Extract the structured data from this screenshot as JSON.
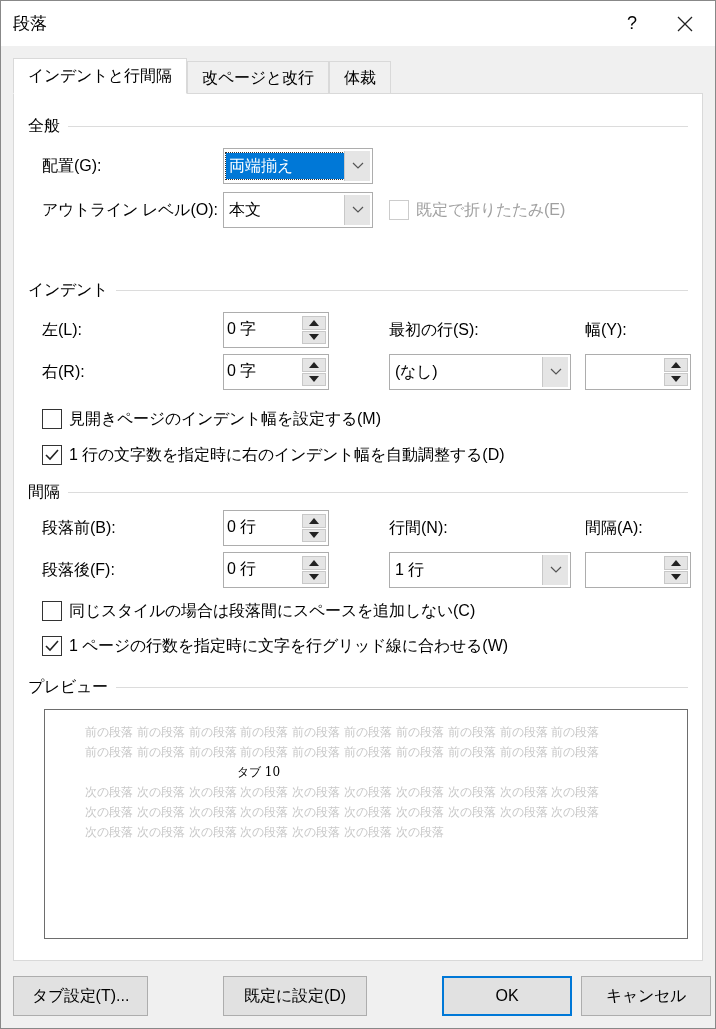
{
  "window": {
    "title": "段落",
    "help": "?"
  },
  "tabs": [
    {
      "label": "インデントと行間隔",
      "selected": true
    },
    {
      "label": "改ページと改行",
      "selected": false
    },
    {
      "label": "体裁",
      "selected": false
    }
  ],
  "general": {
    "title": "全般",
    "alignment": {
      "label": "配置(G):",
      "value": "両端揃え",
      "focused": true
    },
    "outline_level": {
      "label": "アウトライン レベル(O):",
      "value": "本文",
      "focused": false
    },
    "collapse": {
      "label": "既定で折りたたみ(E)",
      "checked": false,
      "disabled": true
    }
  },
  "indent": {
    "title": "インデント",
    "left": {
      "label": "左(L):",
      "value": "0 字"
    },
    "right": {
      "label": "右(R):",
      "value": "0 字"
    },
    "first_line": {
      "label": "最初の行(S):",
      "value": "(なし)",
      "focused": false
    },
    "by": {
      "label": "幅(Y):"
    },
    "checkboxes": [
      {
        "label": "見開きページのインデント幅を設定する(M)",
        "checked": false,
        "disabled": false
      },
      {
        "label": "1 行の文字数を指定時に右のインデント幅を自動調整する(D)",
        "checked": true,
        "disabled": false
      }
    ]
  },
  "spacing": {
    "title": "間隔",
    "before": {
      "label": "段落前(B):",
      "value": "0 行"
    },
    "after": {
      "label": "段落後(F):",
      "value": "0 行"
    },
    "line_spacing": {
      "label": "行間(N):",
      "value": "1 行",
      "focused": false
    },
    "at": {
      "label": "間隔(A):"
    },
    "checkboxes": [
      {
        "label": "同じスタイルの場合は段落間にスペースを追加しない(C)",
        "checked": false,
        "disabled": false
      },
      {
        "label": "1 ページの行数を指定時に文字を行グリッド線に合わせる(W)",
        "checked": true,
        "disabled": false
      }
    ]
  },
  "preview": {
    "title": "プレビュー",
    "lines": [
      {
        "kind": "context",
        "text": "前の段落 前の段落 前の段落 前の段落 前の段落 前の段落 前の段落 前の段落 前の段落 前の段落"
      },
      {
        "kind": "context",
        "text": "前の段落 前の段落 前の段落 前の段落 前の段落 前の段落 前の段落 前の段落 前の段落 前の段落"
      },
      {
        "kind": "sample",
        "text": "タブ 10"
      },
      {
        "kind": "context",
        "text": "次の段落 次の段落 次の段落 次の段落 次の段落 次の段落 次の段落 次の段落 次の段落 次の段落"
      },
      {
        "kind": "context",
        "text": "次の段落 次の段落 次の段落 次の段落 次の段落 次の段落 次の段落 次の段落 次の段落 次の段落"
      },
      {
        "kind": "context",
        "text": "次の段落 次の段落 次の段落 次の段落 次の段落 次の段落 次の段落"
      }
    ]
  },
  "buttons": [
    {
      "label": "タブ設定(T)...",
      "default": false
    },
    {
      "label": "既定に設定(D)",
      "default": false
    },
    {
      "label": "OK",
      "default": true
    },
    {
      "label": "キャンセル",
      "default": false
    }
  ]
}
